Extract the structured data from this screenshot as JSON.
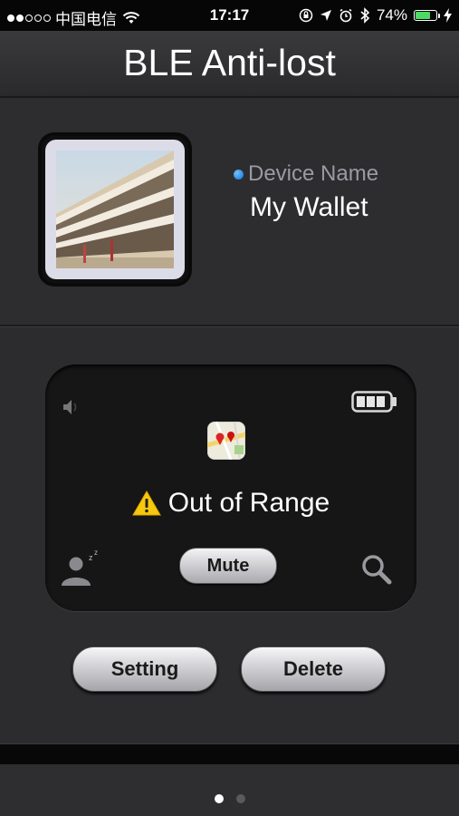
{
  "status_bar": {
    "carrier": "中国电信",
    "time": "17:17",
    "battery_percent": "74%",
    "battery_level": 0.74,
    "signal_bars_filled": 2,
    "signal_bars_total": 5
  },
  "app": {
    "title": "BLE Anti-lost"
  },
  "device": {
    "name_label": "Device Name",
    "name_value": "My Wallet",
    "status_text": "Out of Range"
  },
  "controls": {
    "mute_label": "Mute",
    "setting_label": "Setting",
    "delete_label": "Delete"
  },
  "pager": {
    "total": 2,
    "current": 1
  },
  "icons": {
    "wifi": "wifi-icon",
    "speaker": "speaker-icon",
    "battery": "battery-icon",
    "map": "map-icon",
    "warning": "warning-icon",
    "sleep": "sleep-icon",
    "search": "search-icon"
  },
  "colors": {
    "battery_green": "#4cd964",
    "dot_blue": "#1a8af0",
    "warning_yellow": "#f6c90e",
    "background": "#2c2c2e"
  }
}
